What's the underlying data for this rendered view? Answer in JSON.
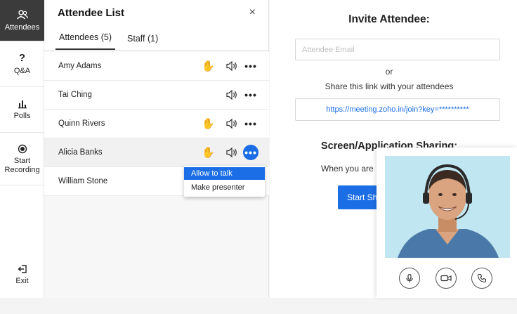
{
  "rail": {
    "attendees": "Attendees",
    "qa": "Q&A",
    "qa_icon": "?",
    "polls": "Polls",
    "start_recording": "Start Recording",
    "exit": "Exit"
  },
  "panel": {
    "title": "Attendee List",
    "close": "×",
    "tabs": [
      {
        "label": "Attendees (5)",
        "active": true
      },
      {
        "label": "Staff (1)",
        "active": false
      }
    ],
    "attendees": [
      {
        "name": "Amy Adams",
        "hand_raised": true
      },
      {
        "name": "Tai Ching",
        "hand_raised": false
      },
      {
        "name": "Quinn Rivers",
        "hand_raised": true
      },
      {
        "name": "Alicia Banks",
        "hand_raised": true
      },
      {
        "name": "William Stone",
        "hand_raised": false
      }
    ],
    "menu": {
      "allow_to_talk": "Allow to talk",
      "make_presenter": "Make presenter"
    }
  },
  "invite": {
    "title": "Invite Attendee:",
    "email_placeholder": "Attendee Email",
    "or": "or",
    "share_text": "Share this link with your attendees",
    "link": "https://meeting.zoho.in/join?key=**********",
    "screen_title": "Screen/Application Sharing:",
    "when_text": "When you are",
    "start_button": "Start Sh"
  },
  "colors": {
    "accent": "#1c6ee6",
    "hand": "#f28a1d",
    "rail_active": "#3b3b3b"
  }
}
